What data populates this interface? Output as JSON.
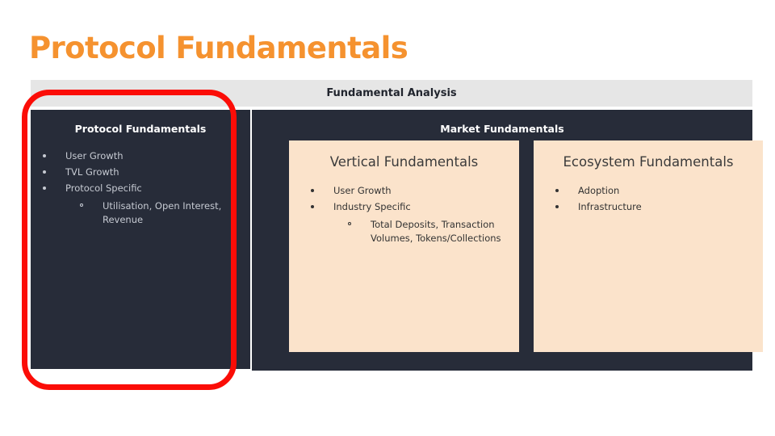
{
  "slide": {
    "title": "Protocol Fundamentals",
    "title_color": "#f5922f"
  },
  "diagram": {
    "banner": {
      "label": "Fundamental Analysis"
    },
    "protocol_panel": {
      "heading": "Protocol Fundamentals",
      "bullets": [
        {
          "level": 1,
          "text": "User Growth"
        },
        {
          "level": 1,
          "text": "TVL Growth"
        },
        {
          "level": 1,
          "text": "Protocol Specific"
        },
        {
          "level": 2,
          "text": "Utilisation, Open Interest, Revenue"
        }
      ]
    },
    "market_panel": {
      "heading": "Market Fundamentals",
      "cards": [
        {
          "title": "Vertical Fundamentals",
          "bullets": [
            {
              "level": 1,
              "text": "User Growth"
            },
            {
              "level": 1,
              "text": "Industry Specific"
            },
            {
              "level": 2,
              "text": "Total Deposits, Transaction Volumes, Tokens/Collections"
            }
          ]
        },
        {
          "title": "Ecosystem Fundamentals",
          "bullets": [
            {
              "level": 1,
              "text": "Adoption"
            },
            {
              "level": 1,
              "text": "Infrastructure"
            }
          ]
        }
      ]
    }
  },
  "annotation": {
    "highlight_color": "#fb0d07",
    "target": "protocol-fundamentals-panel"
  }
}
